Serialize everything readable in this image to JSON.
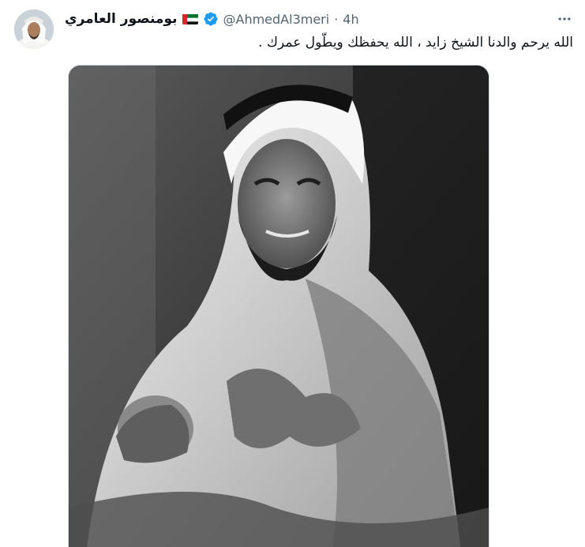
{
  "tweet": {
    "author": {
      "display_name": "بومنصور العامري",
      "handle": "@AhmedAl3meri",
      "avatar_icon": "avatar-photo",
      "flag_icon": "uae-flag-icon",
      "verified_icon": "verified-badge-icon"
    },
    "separator": "·",
    "time": "4h",
    "more_icon": "more-options-icon",
    "text": "الله يرحم والدنا الشيخ زايد ، الله يحفظك ويطّول عمرك .",
    "media": {
      "type": "photo",
      "style": "black-and-white portrait"
    }
  },
  "colors": {
    "text_primary": "#0f1419",
    "text_secondary": "#536471",
    "verified_blue": "#1d9bf0",
    "border": "#cfd9de"
  }
}
